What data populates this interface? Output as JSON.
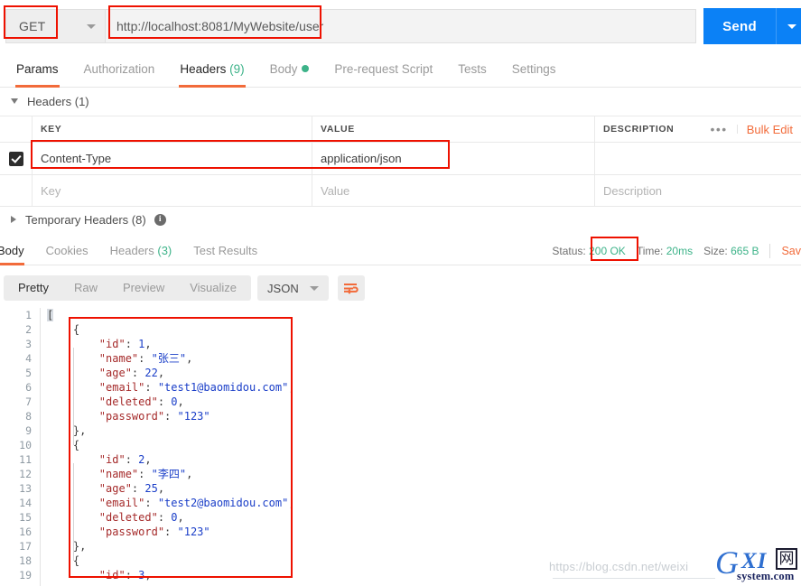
{
  "request": {
    "method": "GET",
    "url": "http://localhost:8081/MyWebsite/user",
    "send_label": "Send",
    "tabs": [
      {
        "label": "Params",
        "count": "",
        "active": false
      },
      {
        "label": "Authorization",
        "count": "",
        "active": false
      },
      {
        "label": "Headers",
        "count": "(9)",
        "active": true
      },
      {
        "label": "Body",
        "count": "",
        "active": false,
        "dot": true
      },
      {
        "label": "Pre-request Script",
        "count": "",
        "active": false
      },
      {
        "label": "Tests",
        "count": "",
        "active": false
      },
      {
        "label": "Settings",
        "count": "",
        "active": false
      }
    ],
    "headers_section_title": "Headers (1)",
    "temp_headers_title": "Temporary Headers (8)",
    "table": {
      "columns": [
        "KEY",
        "VALUE",
        "DESCRIPTION"
      ],
      "bulk_edit_label": "Bulk Edit",
      "more_label": "•••",
      "rows": [
        {
          "checked": true,
          "key": "Content-Type",
          "value": "application/json",
          "description": ""
        }
      ],
      "placeholder_row": {
        "key": "Key",
        "value": "Value",
        "description": "Description"
      }
    }
  },
  "response": {
    "tabs": [
      {
        "label": "Body",
        "count": "",
        "active": true
      },
      {
        "label": "Cookies",
        "count": "",
        "active": false
      },
      {
        "label": "Headers",
        "count": "(3)",
        "active": false
      },
      {
        "label": "Test Results",
        "count": "",
        "active": false
      }
    ],
    "status_label": "Status:",
    "status_value": "200 OK",
    "time_label": "Time:",
    "time_value": "20ms",
    "size_label": "Size:",
    "size_value": "665 B",
    "save_label": "Sav",
    "format_tabs": [
      {
        "label": "Pretty",
        "active": true
      },
      {
        "label": "Raw",
        "active": false
      },
      {
        "label": "Preview",
        "active": false
      },
      {
        "label": "Visualize",
        "active": false
      }
    ],
    "content_type": "JSON",
    "wrap_icon": "word-wrap-icon"
  },
  "json_body": {
    "line_numbers": [
      1,
      2,
      3,
      4,
      5,
      6,
      7,
      8,
      9,
      10,
      11,
      12,
      13,
      14,
      15,
      16,
      17,
      18,
      19
    ],
    "records": [
      {
        "id": 1,
        "name": "张三",
        "age": 22,
        "email": "test1@baomidou.com",
        "deleted": 0,
        "password": "123"
      },
      {
        "id": 2,
        "name": "李四",
        "age": 25,
        "email": "test2@baomidou.com",
        "deleted": 0,
        "password": "123"
      }
    ],
    "lines": [
      {
        "n": 1,
        "indent": 0,
        "segs": [
          {
            "t": "[",
            "c": "p"
          }
        ]
      },
      {
        "n": 2,
        "indent": 1,
        "segs": [
          {
            "t": "{",
            "c": "p"
          }
        ]
      },
      {
        "n": 3,
        "indent": 2,
        "segs": [
          {
            "t": "\"id\"",
            "c": "k"
          },
          {
            "t": ": ",
            "c": "p"
          },
          {
            "t": "1",
            "c": "n"
          },
          {
            "t": ",",
            "c": "p"
          }
        ]
      },
      {
        "n": 4,
        "indent": 2,
        "segs": [
          {
            "t": "\"name\"",
            "c": "k"
          },
          {
            "t": ": ",
            "c": "p"
          },
          {
            "t": "\"张三\"",
            "c": "s"
          },
          {
            "t": ",",
            "c": "p"
          }
        ]
      },
      {
        "n": 5,
        "indent": 2,
        "segs": [
          {
            "t": "\"age\"",
            "c": "k"
          },
          {
            "t": ": ",
            "c": "p"
          },
          {
            "t": "22",
            "c": "n"
          },
          {
            "t": ",",
            "c": "p"
          }
        ]
      },
      {
        "n": 6,
        "indent": 2,
        "segs": [
          {
            "t": "\"email\"",
            "c": "k"
          },
          {
            "t": ": ",
            "c": "p"
          },
          {
            "t": "\"test1@baomidou.com\"",
            "c": "s"
          },
          {
            "t": ",",
            "c": "p"
          }
        ]
      },
      {
        "n": 7,
        "indent": 2,
        "segs": [
          {
            "t": "\"deleted\"",
            "c": "k"
          },
          {
            "t": ": ",
            "c": "p"
          },
          {
            "t": "0",
            "c": "n"
          },
          {
            "t": ",",
            "c": "p"
          }
        ]
      },
      {
        "n": 8,
        "indent": 2,
        "segs": [
          {
            "t": "\"password\"",
            "c": "k"
          },
          {
            "t": ": ",
            "c": "p"
          },
          {
            "t": "\"123\"",
            "c": "s"
          }
        ]
      },
      {
        "n": 9,
        "indent": 1,
        "segs": [
          {
            "t": "},",
            "c": "p"
          }
        ]
      },
      {
        "n": 10,
        "indent": 1,
        "segs": [
          {
            "t": "{",
            "c": "p"
          }
        ]
      },
      {
        "n": 11,
        "indent": 2,
        "segs": [
          {
            "t": "\"id\"",
            "c": "k"
          },
          {
            "t": ": ",
            "c": "p"
          },
          {
            "t": "2",
            "c": "n"
          },
          {
            "t": ",",
            "c": "p"
          }
        ]
      },
      {
        "n": 12,
        "indent": 2,
        "segs": [
          {
            "t": "\"name\"",
            "c": "k"
          },
          {
            "t": ": ",
            "c": "p"
          },
          {
            "t": "\"李四\"",
            "c": "s"
          },
          {
            "t": ",",
            "c": "p"
          }
        ]
      },
      {
        "n": 13,
        "indent": 2,
        "segs": [
          {
            "t": "\"age\"",
            "c": "k"
          },
          {
            "t": ": ",
            "c": "p"
          },
          {
            "t": "25",
            "c": "n"
          },
          {
            "t": ",",
            "c": "p"
          }
        ]
      },
      {
        "n": 14,
        "indent": 2,
        "segs": [
          {
            "t": "\"email\"",
            "c": "k"
          },
          {
            "t": ": ",
            "c": "p"
          },
          {
            "t": "\"test2@baomidou.com\"",
            "c": "s"
          },
          {
            "t": ",",
            "c": "p"
          }
        ]
      },
      {
        "n": 15,
        "indent": 2,
        "segs": [
          {
            "t": "\"deleted\"",
            "c": "k"
          },
          {
            "t": ": ",
            "c": "p"
          },
          {
            "t": "0",
            "c": "n"
          },
          {
            "t": ",",
            "c": "p"
          }
        ]
      },
      {
        "n": 16,
        "indent": 2,
        "segs": [
          {
            "t": "\"password\"",
            "c": "k"
          },
          {
            "t": ": ",
            "c": "p"
          },
          {
            "t": "\"123\"",
            "c": "s"
          }
        ]
      },
      {
        "n": 17,
        "indent": 1,
        "segs": [
          {
            "t": "},",
            "c": "p"
          }
        ]
      },
      {
        "n": 18,
        "indent": 1,
        "segs": [
          {
            "t": "{",
            "c": "p"
          }
        ]
      },
      {
        "n": 19,
        "indent": 2,
        "segs": [
          {
            "t": "\"id\"",
            "c": "k"
          },
          {
            "t": ": ",
            "c": "p"
          },
          {
            "t": "3",
            "c": "n"
          },
          {
            "t": ",",
            "c": "p"
          }
        ]
      }
    ]
  },
  "watermark": {
    "url": "https://blog.csdn.net/weixi",
    "logo_g": "G",
    "logo_xi": "XI",
    "logo_cn": "网",
    "logo_sub": "system.com"
  },
  "colors": {
    "accent_orange": "#f26b3a",
    "send_blue": "#0b81f6",
    "status_green": "#3db389",
    "annotation_red": "#ee1100",
    "json_key": "#a52a2a",
    "json_string": "#1a3ec8"
  }
}
